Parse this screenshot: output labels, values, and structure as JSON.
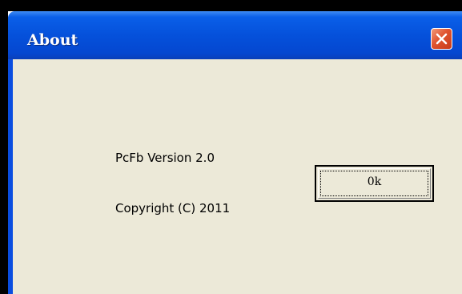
{
  "window": {
    "title": "About",
    "close_icon": "close-icon"
  },
  "content": {
    "version_text": "PcFb Version 2.0",
    "copyright_text": "Copyright (C) 2011"
  },
  "buttons": {
    "ok_label": "0k"
  },
  "colors": {
    "titlebar": "#0551db",
    "client_background": "#ece9d8",
    "close_button": "#e0532e"
  }
}
